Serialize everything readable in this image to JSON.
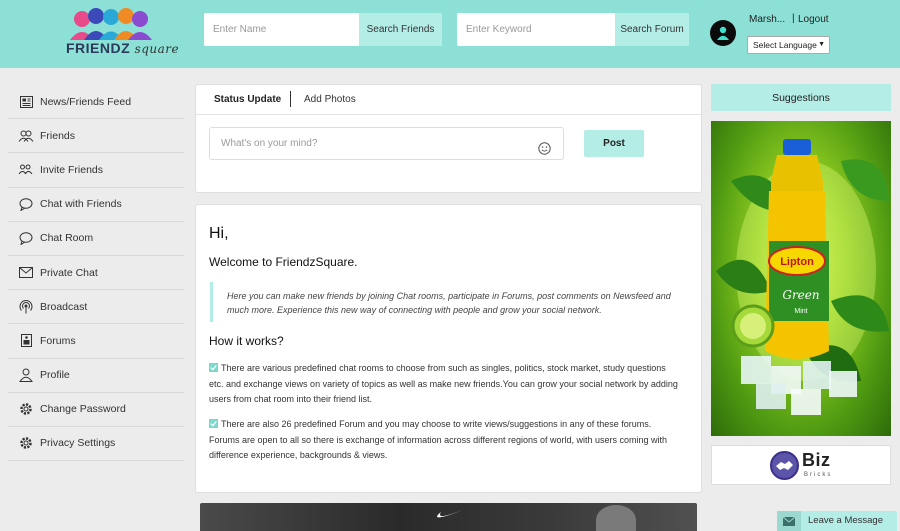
{
  "brand": {
    "logo_text": "FRIENDZ",
    "logo_sub": "square"
  },
  "header": {
    "search_name": {
      "placeholder": "Enter Name",
      "button": "Search Friends"
    },
    "search_forum": {
      "placeholder": "Enter Keyword",
      "button": "Search Forum"
    },
    "user": {
      "name": "Marsh...",
      "separator": "|",
      "logout": "Logout"
    },
    "language": {
      "selected": "Select Language",
      "arrow": "▼"
    }
  },
  "sidebar": {
    "items": [
      {
        "label": "News/Friends Feed",
        "icon": "newspaper-icon"
      },
      {
        "label": "Friends",
        "icon": "friends-icon"
      },
      {
        "label": "Invite Friends",
        "icon": "invite-friends-icon"
      },
      {
        "label": "Chat with Friends",
        "icon": "chat-bubble-icon"
      },
      {
        "label": "Chat Room",
        "icon": "chat-room-icon"
      },
      {
        "label": "Private Chat",
        "icon": "envelope-icon"
      },
      {
        "label": "Broadcast",
        "icon": "broadcast-icon"
      },
      {
        "label": "Forums",
        "icon": "forum-icon"
      },
      {
        "label": "Profile",
        "icon": "user-icon"
      },
      {
        "label": "Change Password",
        "icon": "gear-icon"
      },
      {
        "label": "Privacy Settings",
        "icon": "gear-icon"
      }
    ]
  },
  "status": {
    "tabs": [
      "Status Update",
      "Add Photos"
    ],
    "placeholder": "What's on your mind?",
    "post_label": "Post"
  },
  "welcome": {
    "greeting": "Hi,",
    "title": "Welcome to FriendzSquare.",
    "quote": "Here you can make new friends by joining Chat rooms, participate in Forums, post comments on Newsfeed and much more. Experience this new way of connecting with people and grow your social network.",
    "how_title": "How it works?",
    "points": [
      "There are various predefined chat rooms to choose from such as singles, politics, stock market, study questions etc. and exchange views on variety of topics as well as make new friends.You can grow your social network by adding users from chat room into their friend list.",
      "There are also 26 predefined Forum and you may choose to write views/suggestions in any of these forums. Forums are open to all so there is exchange of information across different regions of world, with users coming with difference experience, backgrounds & views."
    ]
  },
  "right": {
    "suggestions_title": "Suggestions",
    "ad_brand": "Lipton",
    "ad_sub": "Green",
    "ad_flavor": "Mint",
    "biz": {
      "name": "Biz",
      "sub": "Bricks"
    }
  },
  "leave_message": "Leave a Message",
  "colors": {
    "accent": "#b4ede6",
    "header": "#8de0d6",
    "avatar": "#1a1a1a"
  }
}
